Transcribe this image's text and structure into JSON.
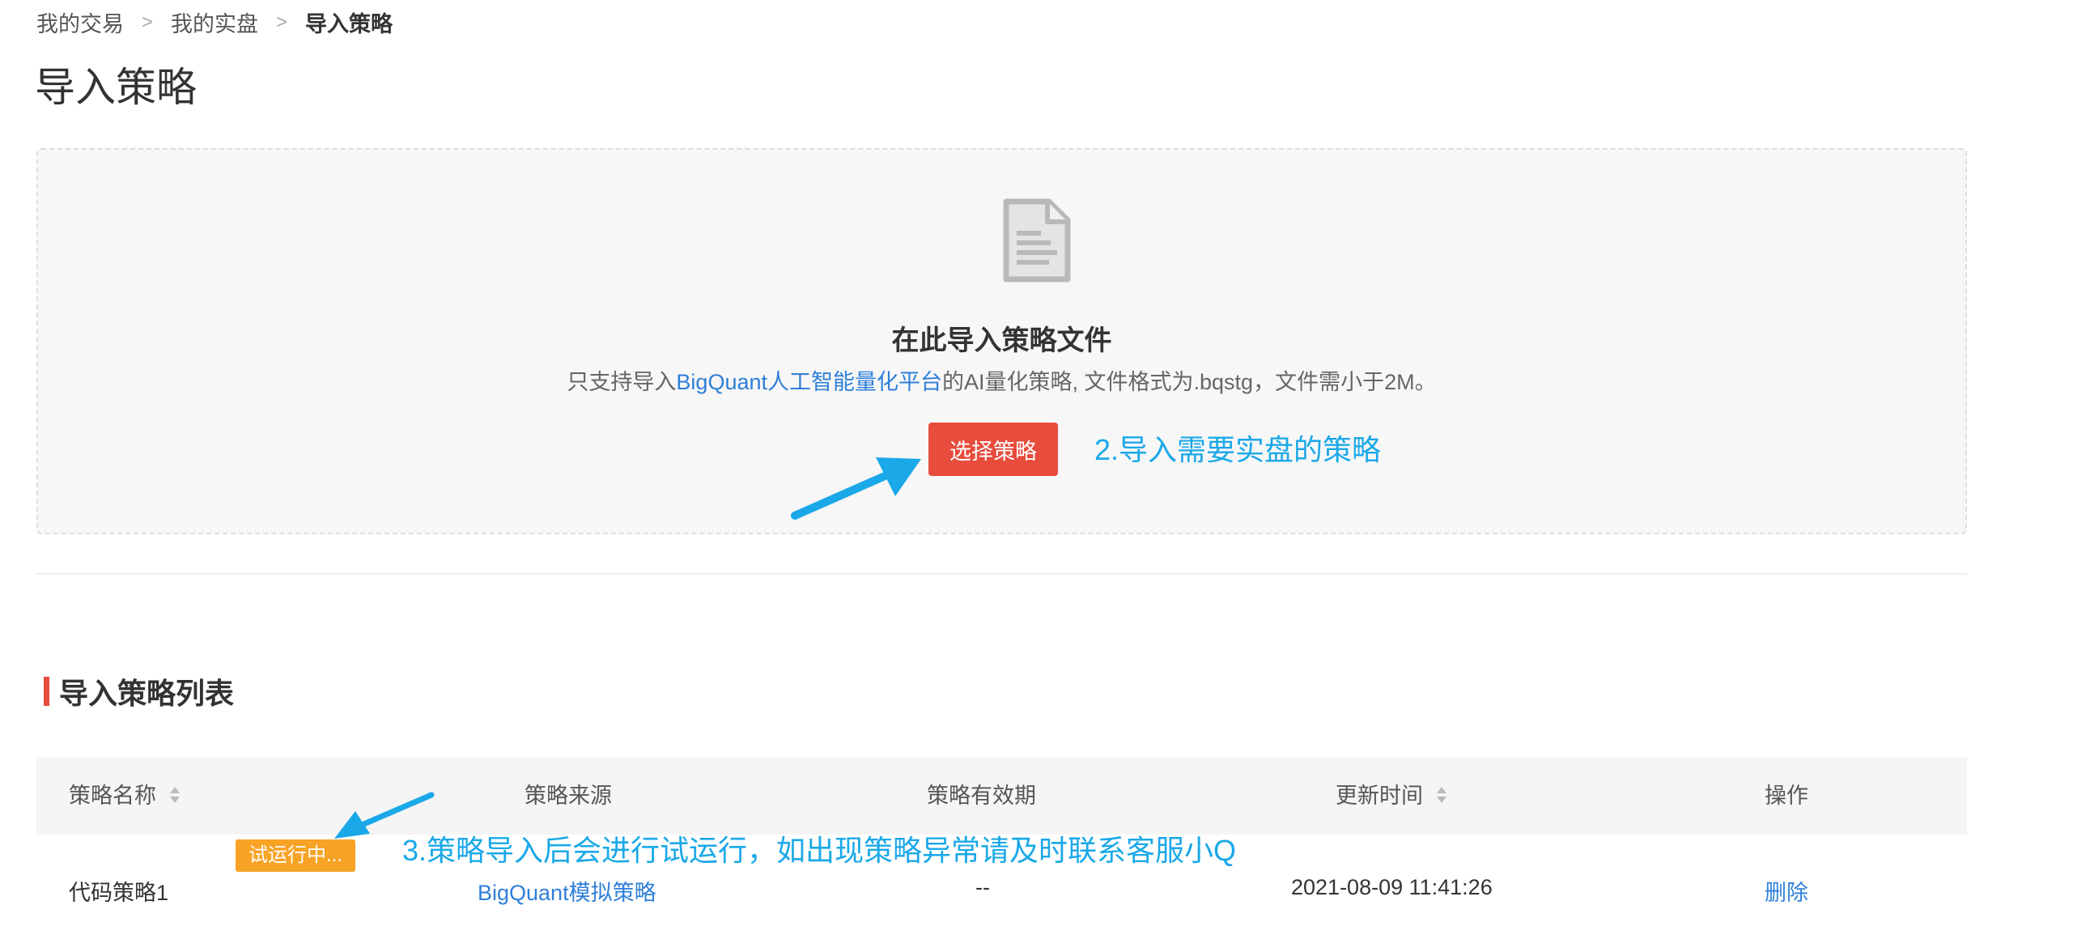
{
  "breadcrumb": {
    "items": [
      "我的交易",
      "我的实盘",
      "导入策略"
    ],
    "separator": ">"
  },
  "page": {
    "title": "导入策略"
  },
  "dropzone": {
    "icon": "document-icon",
    "title": "在此导入策略文件",
    "desc_prefix": "只支持导入",
    "desc_link": "BigQuant人工智能量化平台",
    "desc_suffix": "的AI量化策略, 文件格式为.bqstg，文件需小于2M。",
    "button_label": "选择策略"
  },
  "annotations": {
    "step2": "2.导入需要实盘的策略",
    "step3": "3.策略导入后会进行试运行，如出现策略异常请及时联系客服小Q"
  },
  "list": {
    "title": "导入策略列表",
    "columns": [
      "策略名称",
      "策略来源",
      "策略有效期",
      "更新时间",
      "操作"
    ],
    "rows": [
      {
        "name": "代码策略1",
        "status": "试运行中...",
        "source": "BigQuant模拟策略",
        "validity": "--",
        "updated": "2021-08-09 11:41:26",
        "action": "删除"
      }
    ]
  },
  "colors": {
    "accent_red": "#e74c3c",
    "link_blue": "#2f7fd8",
    "annotation_blue": "#1aa8e8",
    "badge_orange": "#f7a325"
  }
}
